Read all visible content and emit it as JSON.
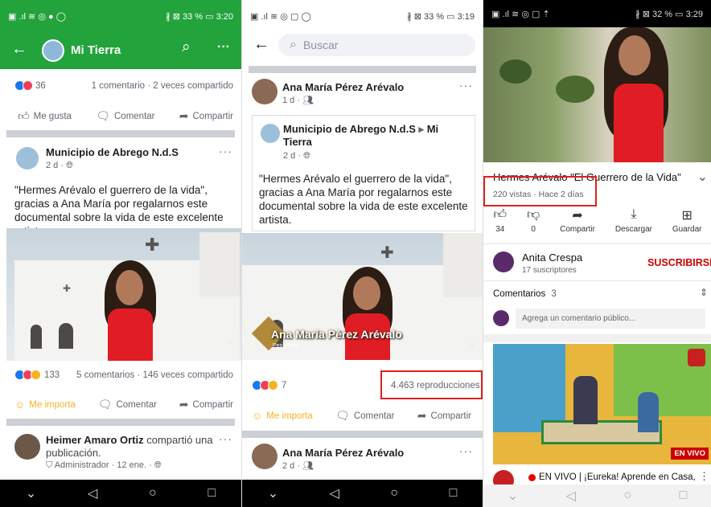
{
  "p1": {
    "status_left": "▣ .ıl ≋ ◎ ● ◯",
    "status_right": "∦ ⊠ 33 % ▭ 3:20",
    "title": "Mi Tierra",
    "top_reactions_count": "36",
    "top_stats": "1 comentario · 2 veces compartido",
    "like": "Me gusta",
    "comment": "Comentar",
    "share": "Compartir",
    "page_name": "Municipio de Abrego  N.d.S",
    "page_time": "2 d · ",
    "post_text": "\"Hermes Arévalo el guerrero de la vida\", gracias a Ana María por regalarnos este documental sobre la vida de este excelente artista.",
    "video_reactions": "133",
    "video_stats": "5 comentarios · 146 veces compartido",
    "me_importa": "Me importa",
    "comment2": "Comentar",
    "share2": "Compartir",
    "next_name": "Heimer Amaro Ortiz",
    "next_action": " compartió una publicación.",
    "next_meta": "Administrador · 12 ene. · "
  },
  "p2": {
    "status_left": "▣ .ıl ≋ ◎ ▢ ◯",
    "status_right": "∦ ⊠ 33 % ▭ 3:19",
    "search_placeholder": "Buscar",
    "author": "Ana María Pérez Arévalo",
    "author_time": "1 d · ",
    "shared_page": "Municipio de Abrego  N.d.S",
    "shared_arrow": "▸",
    "shared_target": "Mi Tierra",
    "shared_time": "2 d · ",
    "post_text": "\"Hermes Arévalo el guerrero de la vida\", gracias a Ana María por regalarnos este documental sobre la vida de este excelente artista.",
    "video_caption": "Ana María Pérez Arévalo",
    "video_caption_sub": "Periodista",
    "reactions_count": "7",
    "views": "4.463 reproducciones",
    "me_importa": "Me importa",
    "comment": "Comentar",
    "share": "Compartir",
    "next_author": "Ana María Pérez Arévalo",
    "next_time": "2 d · "
  },
  "p3": {
    "status_left": "▣ .ıl ≋ ◎ ▢ ⇡",
    "status_right": "∦ ⊠ 32 % ▭ 3:29",
    "video_title": "Hermes Arévalo \"El Guerrero de la Vida\"",
    "video_meta": "220 vistas · Hace 2 días",
    "likes": "34",
    "dislikes": "0",
    "share": "Compartir",
    "download": "Descargar",
    "save": "Guardar",
    "channel": "Anita Crespa",
    "subs": "17 suscriptores",
    "subscribe": "SUSCRIBIRSE",
    "comments_label": "Comentarios",
    "comments_count": "3",
    "comment_placeholder": "Agrega un comentario público...",
    "live_badge": "EN VIVO",
    "next_title": "EN VIVO | ¡Eureka! Aprende en Casa,"
  },
  "colors": {
    "fb_green": "#23a33b",
    "fb_blue": "#1877f2",
    "highlight": "#e02020",
    "yt_red": "#cc0000"
  }
}
